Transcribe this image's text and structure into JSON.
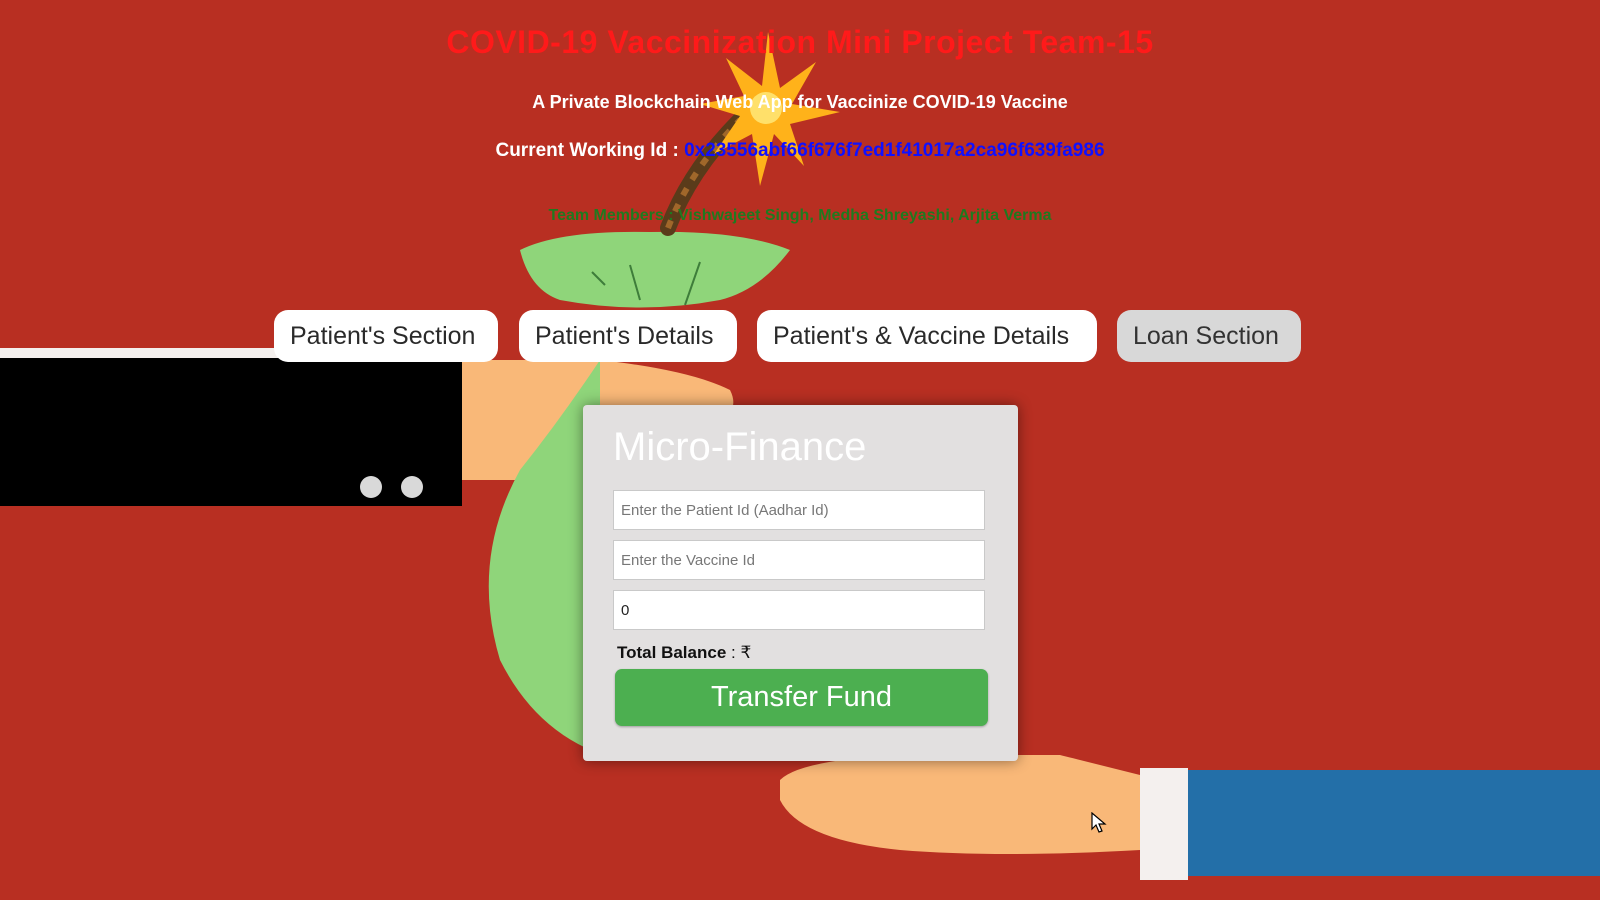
{
  "header": {
    "title": "COVID-19 Vaccinization Mini Project Team-15",
    "subtitle": "A Private Blockchain Web App for Vaccinize COVID-19 Vaccine",
    "working_id_label": "Current Working Id : ",
    "working_id_value": "0x23556abf66f676f7ed1f41017a2ca96f639fa986",
    "team_members": "Team Members : Vishwajeet Singh, Medha Shreyashi, Arjita Verma"
  },
  "nav": {
    "items": [
      {
        "label": "Patient's Section",
        "active": false
      },
      {
        "label": "Patient's Details",
        "active": false
      },
      {
        "label": "Patient's & Vaccine Details",
        "active": false
      },
      {
        "label": "Loan Section",
        "active": true
      }
    ]
  },
  "form": {
    "title": "Micro-Finance",
    "patient_id_placeholder": "Enter the Patient Id (Aadhar Id)",
    "vaccine_id_placeholder": "Enter the Vaccine Id",
    "amount_value": "0",
    "balance_label": "Total Balance",
    "balance_sep": " : ₹",
    "submit_label": "Transfer Fund"
  },
  "colors": {
    "background": "#b82f22",
    "title": "#ff1a1a",
    "working_id": "#1010ff",
    "team": "#1f7a1f",
    "button": "#4caf50"
  }
}
